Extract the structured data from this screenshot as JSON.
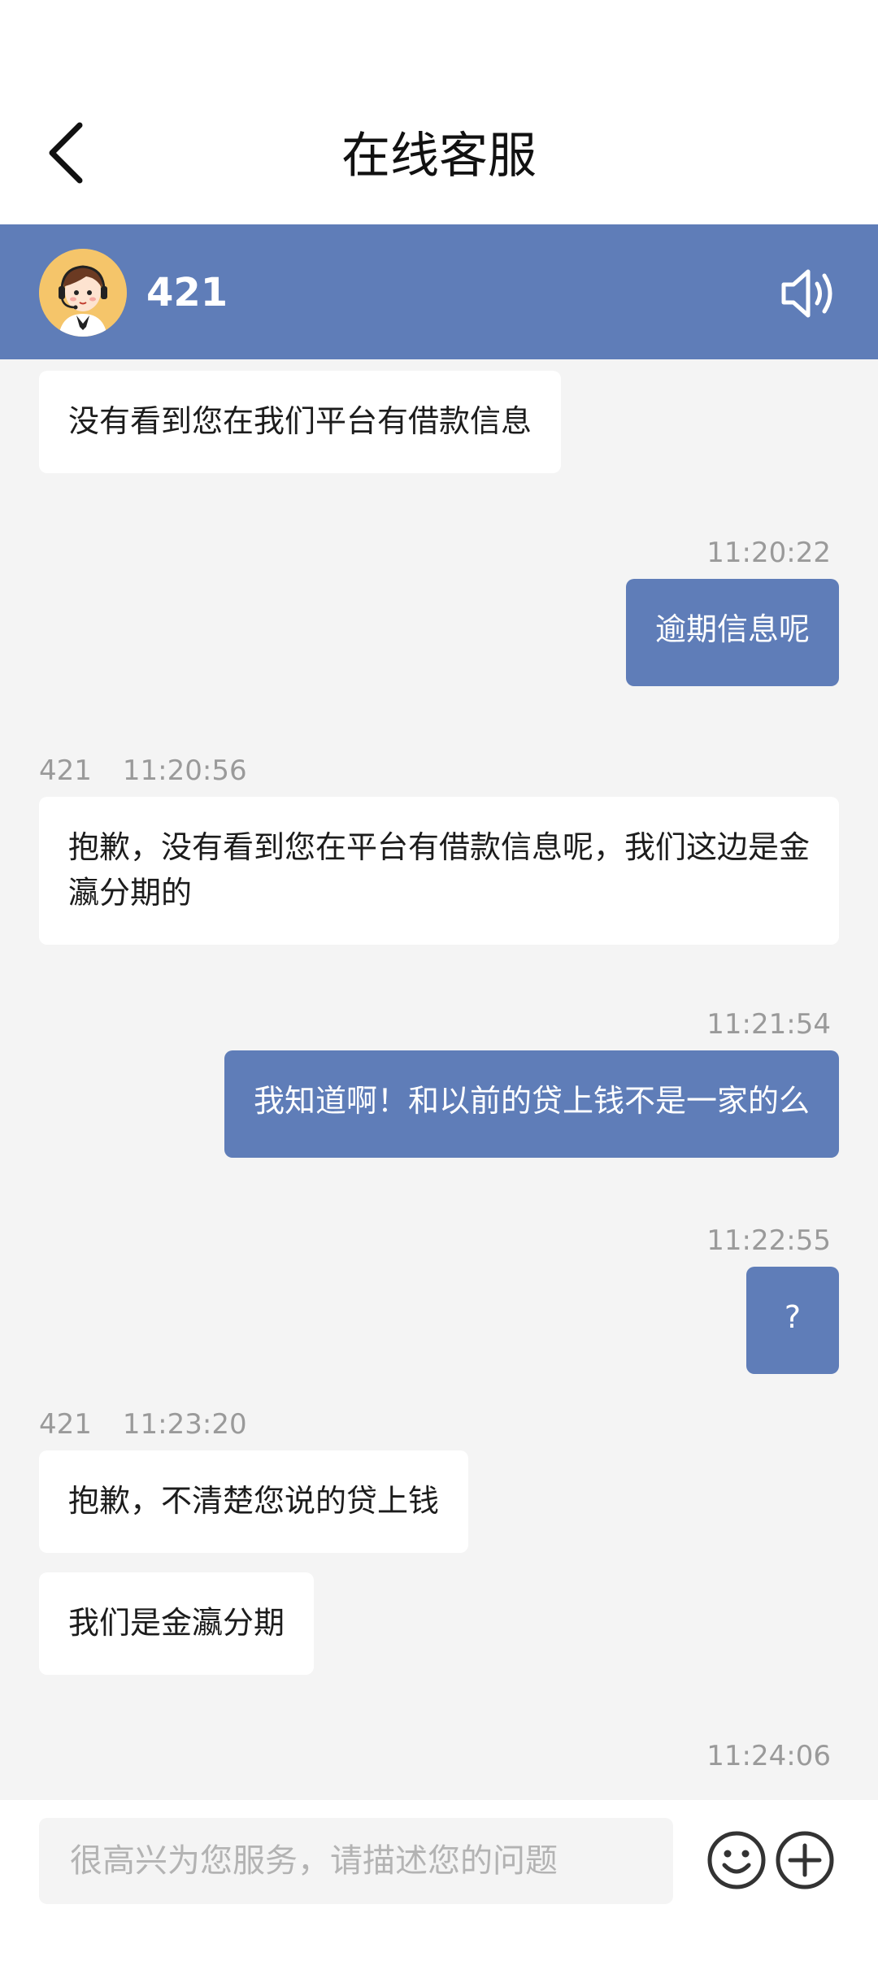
{
  "header": {
    "title": "在线客服",
    "back_icon": "chevron-left-icon"
  },
  "agent_bar": {
    "name": "421",
    "avatar_icon": "support-agent-avatar",
    "sound_icon": "speaker-icon",
    "background": "#5f7db8"
  },
  "messages": [
    {
      "side": "agent",
      "text": "没有看到您在我们平台有借款信息"
    },
    {
      "side": "user",
      "time": "11:20:22",
      "text": "逾期信息呢"
    },
    {
      "side": "agent",
      "sender": "421",
      "time": "11:20:56",
      "text": "抱歉，没有看到您在平台有借款信息呢，我们这边是金瀛分期的"
    },
    {
      "side": "user",
      "time": "11:21:54",
      "text": "我知道啊！和以前的贷上钱不是一家的么"
    },
    {
      "side": "user",
      "time": "11:22:55",
      "text": "?"
    },
    {
      "side": "agent",
      "sender": "421",
      "time": "11:23:20",
      "text": "抱歉，不清楚您说的贷上钱"
    },
    {
      "side": "agent",
      "text": "我们是金瀛分期"
    },
    {
      "side": "user",
      "time": "11:24:06"
    }
  ],
  "input_bar": {
    "placeholder": "很高兴为您服务，请描述您的问题",
    "emoji_icon": "emoji-icon",
    "plus_icon": "plus-circle-icon"
  },
  "colors": {
    "accent": "#5f7db8",
    "chat_background": "#f4f4f4"
  }
}
